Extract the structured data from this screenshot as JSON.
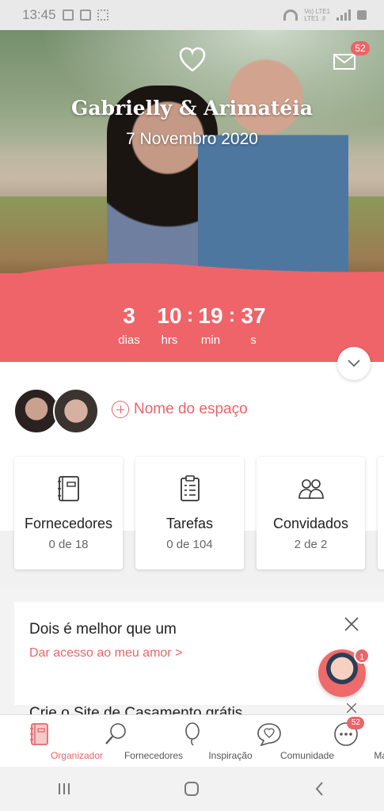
{
  "status_bar": {
    "time": "13:45",
    "network_line1": "Vo) LTE1",
    "network_line2": "LTE1 .il"
  },
  "hero": {
    "couple_names": "Gabrielly & Arimatéia",
    "wedding_date": "7 Novembro 2020",
    "mail_badge": "52"
  },
  "countdown": {
    "days": "3",
    "days_label": "dias",
    "hours": "10",
    "hours_label": "hrs",
    "minutes": "19",
    "minutes_label": "min",
    "seconds": "37",
    "seconds_label": "s",
    "separator": ":"
  },
  "space": {
    "add_label": "Nome do espaço"
  },
  "cards": [
    {
      "title": "Fornecedores",
      "count": "0 de 18",
      "icon": "notebook-icon"
    },
    {
      "title": "Tarefas",
      "count": "0 de 104",
      "icon": "clipboard-icon"
    },
    {
      "title": "Convidados",
      "count": "2 de 2",
      "icon": "guests-icon"
    }
  ],
  "tip": {
    "title": "Dois é melhor que um",
    "link": "Dar acesso ao meu amor",
    "link_arrow": ">",
    "next_title": "Crie o Site de Casamento grátis"
  },
  "assistant": {
    "badge": "1"
  },
  "bottom_nav": [
    {
      "label": "Organizador",
      "active": true
    },
    {
      "label": "Fornecedores",
      "active": false
    },
    {
      "label": "Inspiração",
      "active": false
    },
    {
      "label": "Comunidade",
      "active": false
    },
    {
      "label": "Mais",
      "active": false,
      "badge": "52"
    }
  ],
  "colors": {
    "accent": "#ef6469",
    "accent_text": "#e8666a"
  }
}
